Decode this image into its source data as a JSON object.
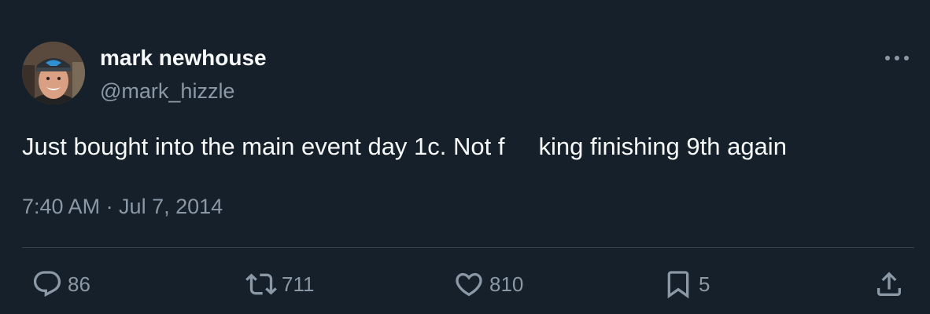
{
  "author": {
    "display_name": "mark newhouse",
    "handle": "@mark_hizzle"
  },
  "tweet": {
    "text": "Just bought into the main event day 1c. Not f     king finishing 9th again",
    "timestamp": "7:40 AM · Jul 7, 2014"
  },
  "actions": {
    "replies": "86",
    "retweets": "711",
    "likes": "810",
    "bookmarks": "5"
  },
  "icons": {
    "more": "more-horizontal-icon",
    "reply": "reply-icon",
    "retweet": "retweet-icon",
    "like": "heart-icon",
    "bookmark": "bookmark-icon",
    "share": "share-icon"
  },
  "colors": {
    "background": "#15202b",
    "primary_text": "#f7f9f9",
    "secondary_text": "#8b98a5",
    "divider": "#38444d"
  }
}
